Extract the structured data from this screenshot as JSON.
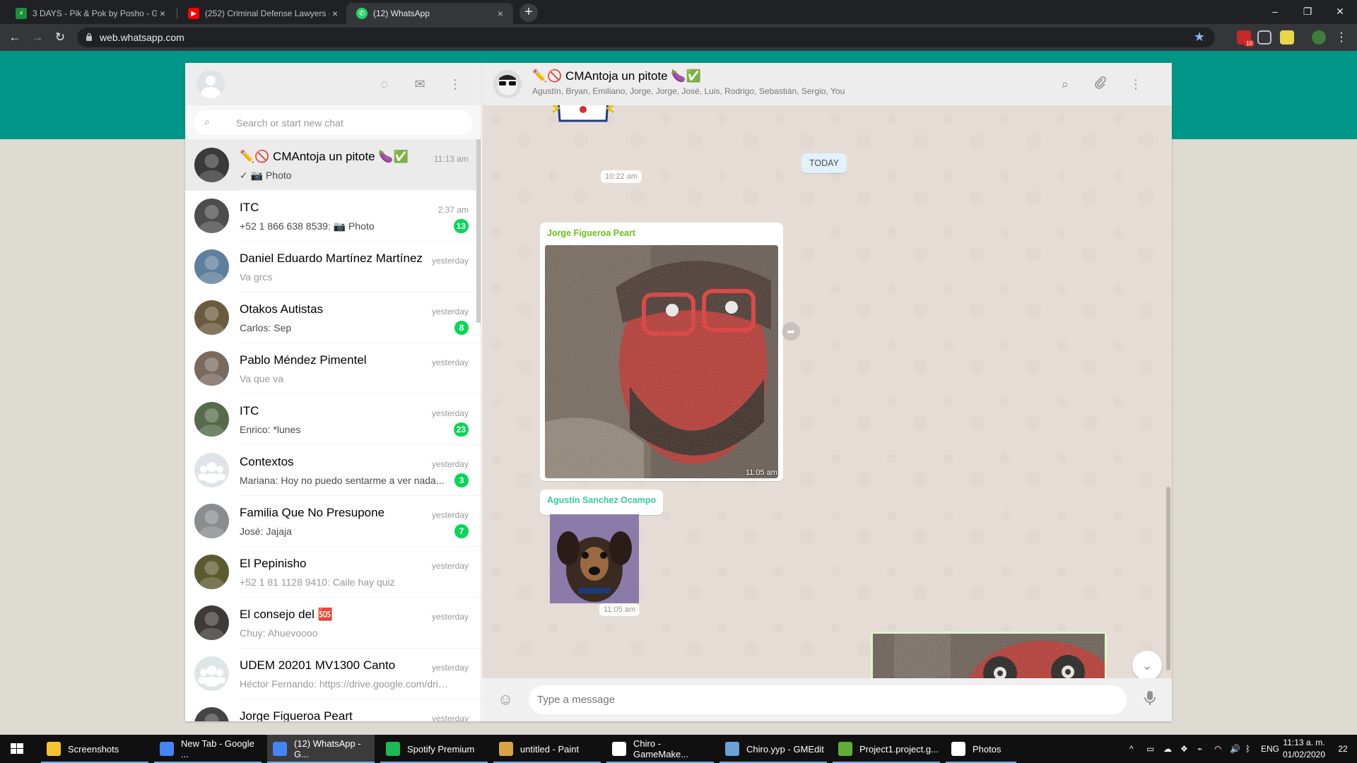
{
  "browser": {
    "tabs": [
      {
        "title": "3 DAYS - Pik & Pok by Posho - G",
        "close": "×",
        "favicon": "game-icon",
        "color": "#1b8f3a"
      },
      {
        "title": "(252) Criminal Defense Lawyers -",
        "close": "×",
        "favicon": "youtube-icon",
        "color": "#ff0000"
      },
      {
        "title": "(12) WhatsApp",
        "close": "×",
        "favicon": "whatsapp-icon",
        "color": "#25d366"
      }
    ],
    "new_tab": "+",
    "window_controls": {
      "minimize": "–",
      "restore": "❐",
      "close": "✕"
    },
    "url": "web.whatsapp.com",
    "nav": {
      "back": "←",
      "forward": "→",
      "reload": "↻"
    },
    "star": "★",
    "extension_badge": "10"
  },
  "whatsapp": {
    "left": {
      "search_placeholder": "Search or start new chat",
      "search_icon": "⌕",
      "header_icons": {
        "status": "◌",
        "new_chat": "✉",
        "menu": "⋮"
      }
    },
    "chats": [
      {
        "name": "✏️🚫 CMAntoja un pitote 🍆✅",
        "time": "11:13 am",
        "preview": "✓ 📷 Photo",
        "badge": "",
        "bold": false,
        "active": true,
        "avatar_color": "#3a3a3a"
      },
      {
        "name": "ITC",
        "time": "2:37 am",
        "preview": "+52 1 866 638 8539: 📷 Photo",
        "badge": "13",
        "bold": true,
        "active": false,
        "avatar_color": "#4d4d4d"
      },
      {
        "name": "Daniel Eduardo Martínez Martínez",
        "time": "yesterday",
        "preview": "Va grcs",
        "badge": "",
        "bold": false,
        "active": false,
        "avatar_color": "#5f7f9c"
      },
      {
        "name": "Otakos Autistas",
        "time": "yesterday",
        "preview": "Carlos: Sep",
        "badge": "8",
        "bold": true,
        "active": false,
        "avatar_color": "#6b5b3e"
      },
      {
        "name": "Pablo Méndez Pimentel",
        "time": "yesterday",
        "preview": "Va que va",
        "badge": "",
        "bold": false,
        "active": false,
        "avatar_color": "#7a6a5e"
      },
      {
        "name": "ITC",
        "time": "yesterday",
        "preview": "Enrico: *lunes",
        "badge": "23",
        "bold": true,
        "active": false,
        "avatar_color": "#556b4a"
      },
      {
        "name": "Contextos",
        "time": "yesterday",
        "preview": "Mariana: Hoy no puedo sentarme a ver nada...",
        "badge": "3",
        "bold": true,
        "active": false,
        "avatar_color": "#dfe5e7"
      },
      {
        "name": "Familia Que No Presupone",
        "time": "yesterday",
        "preview": "José: Jajaja",
        "badge": "7",
        "bold": true,
        "active": false,
        "avatar_color": "#8a8c8e"
      },
      {
        "name": "El Pepinisho",
        "time": "yesterday",
        "preview": "+52 1 81 1128 9410: Caile hay quiz",
        "badge": "",
        "bold": false,
        "active": false,
        "avatar_color": "#5c5a30"
      },
      {
        "name": "El consejo del 🆘",
        "time": "yesterday",
        "preview": "Chuy: Ahuevoooo",
        "badge": "",
        "bold": false,
        "active": false,
        "avatar_color": "#3d3a38"
      },
      {
        "name": "UDEM 20201 MV1300 Canto",
        "time": "yesterday",
        "preview": "Héctor Fernando: https://drive.google.com/drive...",
        "badge": "",
        "bold": false,
        "active": false,
        "avatar_color": "#dfe5e7"
      },
      {
        "name": "Jorge Figueroa Peart",
        "time": "yesterday",
        "preview": "",
        "badge": "",
        "bold": false,
        "active": false,
        "avatar_color": "#444"
      }
    ],
    "conversation": {
      "title": "✏️🚫 CMAntoja un pitote 🍆✅",
      "members": "Agustín, Bryan, Emiliano, Jorge, Jorge, José, Luis, Rodrigo, Sebastián, Sergio, You",
      "header_icons": {
        "search": "⌕",
        "attach": "📎",
        "menu": "⋮"
      },
      "day_divider": "TODAY",
      "messages": [
        {
          "time": "10:22 am"
        },
        {
          "sender": "Jorge Figueroa Peart",
          "sender_color": "#6bbf1a",
          "time": "11:05 am",
          "type": "photo"
        },
        {
          "sender": "Agustín Sanchez Ocampo",
          "sender_color": "#35cd96",
          "time": "11:05 am",
          "type": "photo"
        },
        {
          "type": "photo",
          "outgoing": true
        }
      ],
      "compose_placeholder": "Type a message",
      "emoji_icon": "☺",
      "mic_icon": "🎤",
      "forward_icon": "➦",
      "scroll_down_icon": "⌄"
    }
  },
  "taskbar": {
    "items": [
      {
        "label": "Screenshots",
        "color": "#f4c430",
        "active": false
      },
      {
        "label": "New Tab - Google ...",
        "color": "#4285f4",
        "active": false
      },
      {
        "label": "(12) WhatsApp - G...",
        "color": "#4285f4",
        "active": true
      },
      {
        "label": "Spotify Premium",
        "color": "#1db954",
        "active": false
      },
      {
        "label": "untitled - Paint",
        "color": "#d9a441",
        "active": false
      },
      {
        "label": "Chiro - GameMake...",
        "color": "#ffffff",
        "active": false
      },
      {
        "label": "Chiro.yyp - GMEdit",
        "color": "#6aa0d8",
        "active": false
      },
      {
        "label": "Project1.project.g...",
        "color": "#5fae3a",
        "active": false
      },
      {
        "label": "Photos",
        "color": "#ffffff",
        "active": false
      }
    ],
    "language": "ENG",
    "time": "11:13 a. m.",
    "date": "01/02/2020",
    "notifications": "22",
    "tray_chevron": "^"
  }
}
